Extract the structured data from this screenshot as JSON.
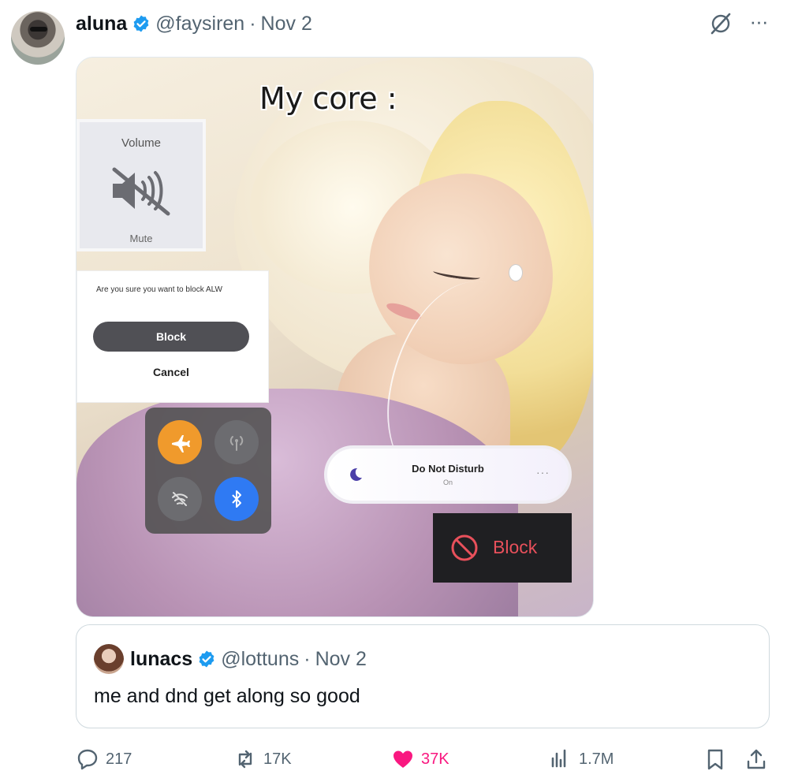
{
  "post": {
    "author_name": "aluna",
    "handle": "@faysiren",
    "separator": "·",
    "date": "Nov 2",
    "more_label": "···",
    "media": {
      "caption": "My core :",
      "volume_title": "Volume",
      "volume_label": "Mute",
      "dialog_question": "Are you sure you want to block ALW",
      "dialog_block": "Block",
      "dialog_cancel": "Cancel",
      "dnd_title": "Do Not Disturb",
      "dnd_status": "On",
      "dnd_more": "···",
      "block_label": "Block"
    }
  },
  "quote": {
    "author_name": "lunacs",
    "handle": "@lottuns",
    "separator": "·",
    "date": "Nov 2",
    "text": "me and dnd get along so good"
  },
  "actions": {
    "replies": "217",
    "reposts": "17K",
    "likes": "37K",
    "views": "1.7M"
  },
  "colors": {
    "verified": "#1d9bf0",
    "like": "#f91880",
    "muted": "#536471",
    "airplane": "#f09a2c",
    "bluetooth": "#2f7af3",
    "block_red": "#e8505b"
  },
  "icons": [
    "verified-badge-icon",
    "grok-icon",
    "more-icon",
    "reply-icon",
    "repost-icon",
    "like-icon",
    "views-icon",
    "bookmark-icon",
    "share-icon"
  ]
}
